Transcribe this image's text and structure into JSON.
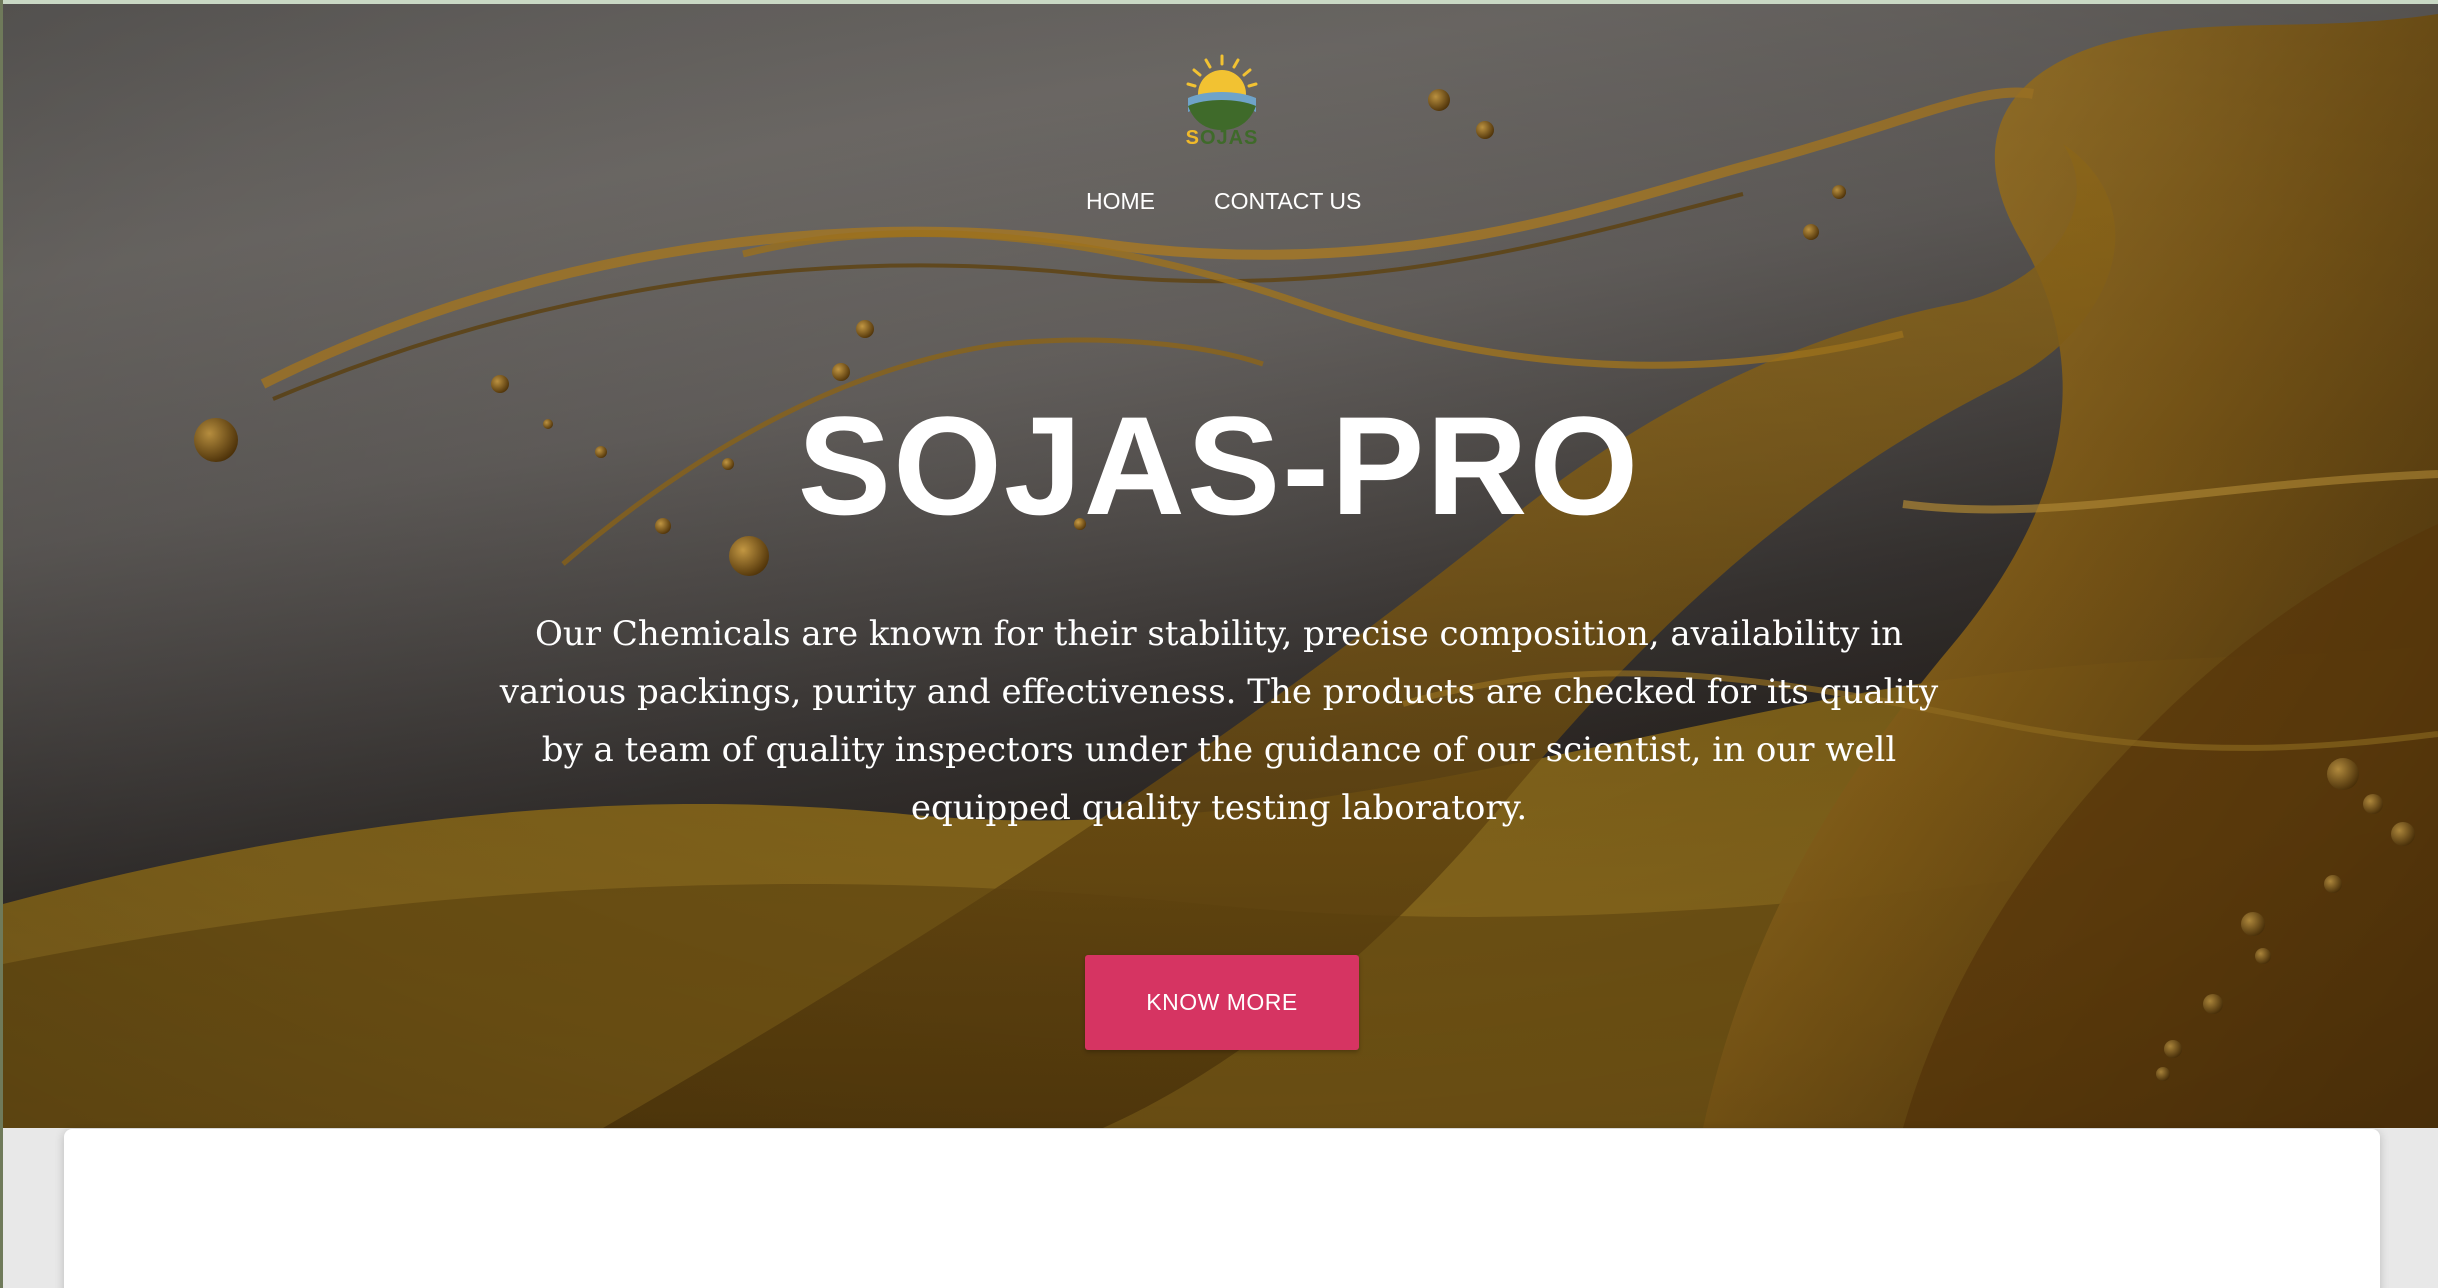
{
  "header": {
    "logo": {
      "icon": "sun-over-hills-logo",
      "text_first_letter": "S",
      "text_rest": "OJAS",
      "colors": {
        "sun": "#f2c232",
        "hill": "#3f6a2a",
        "wave": "#6fa3c9"
      }
    },
    "nav": [
      {
        "label": "HOME"
      },
      {
        "label": "CONTACT US"
      }
    ]
  },
  "hero": {
    "title": "SOJAS-PRO",
    "description": "Our Chemicals are known for their stability, precise composition, availability in various packings, purity and effectiveness. The products are checked for its quality by a team of quality inspectors under the guidance of our scientist, in our well equipped quality testing laboratory.",
    "cta_label": "KNOW MORE",
    "background": "golden-oil-splash-image"
  },
  "colors": {
    "accent": "#d63462",
    "text_on_hero": "#ffffff",
    "card": "#ffffff"
  }
}
